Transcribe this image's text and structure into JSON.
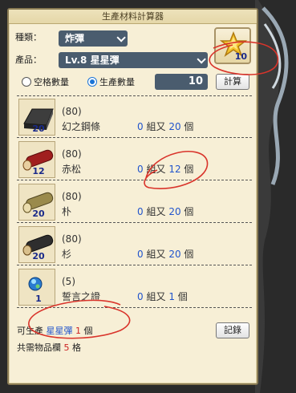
{
  "window": {
    "title": "生產材料計算器"
  },
  "type_select": {
    "label": "種類：",
    "value": "炸彈"
  },
  "product_select": {
    "label": "產品：",
    "value": "Lv.8 星星彈"
  },
  "product_icon": {
    "icon": "star-icon",
    "count": "10"
  },
  "mode": {
    "option_slots": "空格數量",
    "option_quantity": "生產數量",
    "selected": "生產數量",
    "quantity_value": "10"
  },
  "calculate_button": "計算",
  "record_button": "記錄",
  "set_word": "組又",
  "unit_word": "個",
  "materials": [
    {
      "icon": "steel-bar-icon",
      "owned": "20",
      "need": "(80)",
      "name": "幻之鋼條",
      "sets": "0",
      "remainder": "20"
    },
    {
      "icon": "red-pine-log-icon",
      "owned": "12",
      "need": "(80)",
      "name": "赤松",
      "sets": "0",
      "remainder": "12"
    },
    {
      "icon": "magnolia-log-icon",
      "owned": "20",
      "need": "(80)",
      "name": "朴",
      "sets": "0",
      "remainder": "20"
    },
    {
      "icon": "cedar-log-icon",
      "owned": "20",
      "need": "(80)",
      "name": "杉",
      "sets": "0",
      "remainder": "20"
    },
    {
      "icon": "oath-proof-icon",
      "owned": "1",
      "need": "(5)",
      "name": "誓言之證",
      "sets": "0",
      "remainder": "1"
    }
  ],
  "footer": {
    "can_produce_prefix": "可生產",
    "product_name": "星星彈",
    "amount": "1",
    "unit": "個",
    "slots_prefix": "共需物品欄",
    "slots": "5",
    "slots_unit": "格"
  },
  "colors": {
    "accent_blue": "#2255cc",
    "alert_red": "#cc2222",
    "field_bg": "#4a5c6e"
  }
}
